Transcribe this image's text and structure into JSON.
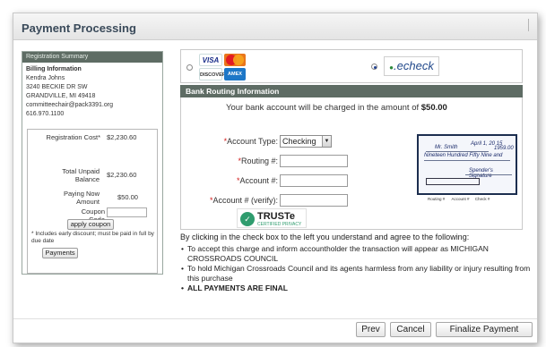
{
  "dialog": {
    "title": "Payment Processing"
  },
  "summary": {
    "header": "Registration Summary",
    "billing_title": "Billing Information",
    "billing_lines": [
      "Kendra Johns",
      "3240 BECKIE DR SW",
      "GRANDVILLE, MI 49418",
      "committeechair@pack3391.org",
      "616.970.1100"
    ],
    "registration_cost_label": "Registration Cost*",
    "registration_cost": "$2,230.60",
    "total_unpaid_label": "Total Unpaid Balance",
    "total_unpaid": "$2,230.60",
    "paying_now_label": "Paying Now Amount",
    "paying_now": "$50.00",
    "coupon_label": "Coupon Code",
    "apply_coupon": "apply coupon",
    "note": "* Includes early discount; must be paid in full by due date",
    "payments_button": "Payments"
  },
  "payment_methods": {
    "card_labels": [
      "VISA",
      "DISCOVER",
      "AMEX"
    ],
    "echeck_label": "echeck",
    "selected": "echeck"
  },
  "bank": {
    "header": "Bank Routing Information",
    "charge_prefix": "Your bank account will be charged in the amount of",
    "charge_amount": "$50.00",
    "account_type_label": "Account Type:",
    "account_type_value": "Checking",
    "routing_label": "Routing #:",
    "account_label": "Account #:",
    "account_verify_label": "Account # (verify):",
    "required_mark": "*",
    "check_labels": [
      "Routing #",
      "Account #",
      "Check #"
    ],
    "check_handwriting": [
      "Mr. Smith",
      "Nineteen Hundred Fifty Nine and",
      "Spender's Signature",
      "April 1, 20 15",
      "1959.00"
    ],
    "truste_name": "TRUSTe",
    "truste_sub": "CERTIFIED PRIVACY"
  },
  "agreement": {
    "lead": "By clicking in the check box to the left you understand and agree to the following:",
    "items": [
      "To accept this charge and inform accountholder the transaction will appear as MICHIGAN CROSSROADS COUNCIL",
      "To hold Michigan Crossroads Council and its agents harmless from any liability or injury resulting from this purchase",
      "ALL PAYMENTS ARE FINAL"
    ],
    "checked": true
  },
  "footer": {
    "prev": "Prev",
    "cancel": "Cancel",
    "finalize": "Finalize Payment"
  }
}
